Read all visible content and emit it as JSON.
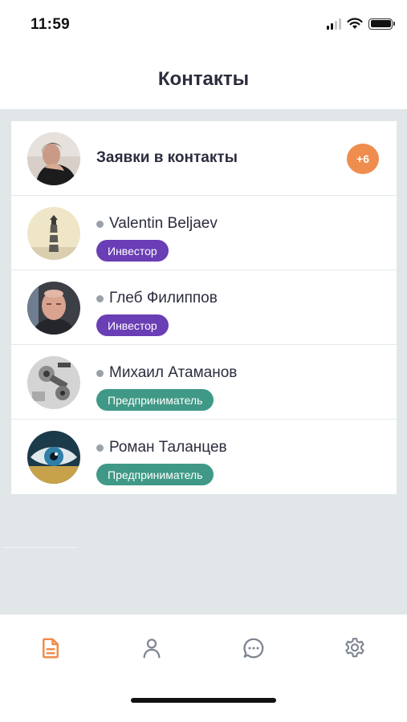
{
  "status_bar": {
    "time": "11:59"
  },
  "header": {
    "title": "Контакты"
  },
  "requests": {
    "label": "Заявки в контакты",
    "count": "+6"
  },
  "contacts": [
    {
      "name": "Valentin Beljaev",
      "role": "Инвестор"
    },
    {
      "name": "Глеб Филиппов",
      "role": "Инвестор"
    },
    {
      "name": "Михаил Атаманов",
      "role": "Предприниматель"
    },
    {
      "name": "Роман Таланцев",
      "role": "Предприниматель"
    }
  ],
  "tabs": [
    {
      "icon": "document-icon",
      "active": true
    },
    {
      "icon": "person-icon",
      "active": false
    },
    {
      "icon": "chat-icon",
      "active": false
    },
    {
      "icon": "gear-icon",
      "active": false
    }
  ],
  "colors": {
    "accent": "#ee8d4d",
    "investor": "#6a3eb5",
    "entrepreneur": "#3f9986",
    "inactive_icon": "#7d8590",
    "background": "#e1e6e8"
  }
}
